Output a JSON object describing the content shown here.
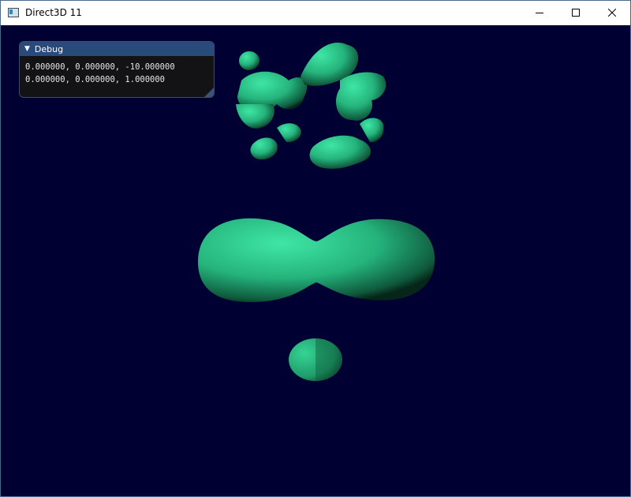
{
  "window": {
    "title": "Direct3D 11",
    "icon": "app-window-icon",
    "controls": [
      "minimize-icon",
      "maximize-icon",
      "close-icon"
    ]
  },
  "viewport": {
    "background_color": "#000033",
    "object_color": "#2ecc8e"
  },
  "debug": {
    "title": "Debug",
    "expand_icon": "triangle-down-icon",
    "lines": [
      "0.000000, 0.000000, -10.000000",
      "0.000000, 0.000000, 1.000000"
    ]
  }
}
